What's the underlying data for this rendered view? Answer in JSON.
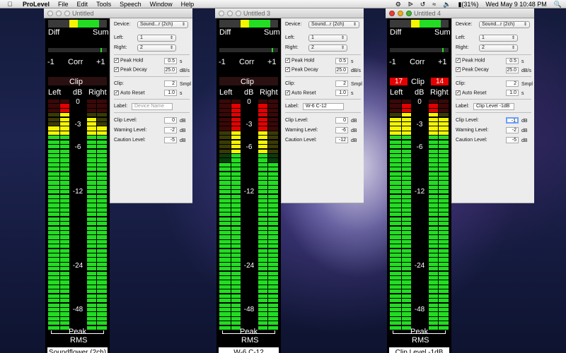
{
  "menubar": {
    "app_name": "ProLevel",
    "items": [
      "File",
      "Edit",
      "Tools",
      "Speech",
      "Window",
      "Help"
    ],
    "battery": "(31%)",
    "clock": "Wed May 9  10:48 PM"
  },
  "meter_labels": {
    "diff": "Diff",
    "sum": "Sum",
    "corr_min": "-1",
    "corr": "Corr",
    "corr_max": "+1",
    "clip": "Clip",
    "left": "Left",
    "db": "dB",
    "right": "Right",
    "scale": [
      "0",
      "-3",
      "-6",
      "-12",
      "-24",
      "-48"
    ],
    "peak": "Peak",
    "rms": "RMS"
  },
  "panel_labels": {
    "device": "Device:",
    "left": "Left:",
    "right": "Right:",
    "peak_hold": "Peak Hold",
    "peak_decay": "Peak Decay",
    "clip": "Clip:",
    "auto_reset": "Auto Reset",
    "label": "Label:",
    "clip_level": "Clip Level:",
    "warning_level": "Warning Level:",
    "caution_level": "Caution Level:",
    "unit_s": "s",
    "unit_dbs": "dB/s",
    "unit_smpl": "Smpl",
    "unit_db": "dB"
  },
  "windows": [
    {
      "title": "Untitled",
      "bottom_label": "Soundflower (2ch)",
      "device": "Sound...r (2ch)",
      "left_channel": "1",
      "right_channel": "2",
      "peak_hold": "0.5",
      "peak_decay": "25.0",
      "clip_samples": "2",
      "auto_reset": "1.0",
      "label_placeholder": "Device Name",
      "label_value": "",
      "clip_level": "0",
      "warning_level": "-2",
      "caution_level": "-5",
      "clip_left": "",
      "clip_right": "",
      "active": false,
      "levels": {
        "left_rms": 0.89,
        "left_peak": 0.98,
        "right_rms": 0.89,
        "right_peak": 0.92
      }
    },
    {
      "title": "Untitled 3",
      "bottom_label": "W-6 C-12",
      "device": "Sound...r (2ch)",
      "left_channel": "1",
      "right_channel": "2",
      "peak_hold": "0.5",
      "peak_decay": "25.0",
      "clip_samples": "2",
      "auto_reset": "1.0",
      "label_placeholder": "",
      "label_value": "W-6 C-12",
      "clip_level": "0",
      "warning_level": "-6",
      "caution_level": "-12",
      "clip_left": "",
      "clip_right": "",
      "active": false,
      "levels": {
        "left_rms": 0.73,
        "left_peak": 0.98,
        "right_rms": 0.73,
        "right_peak": 0.98
      }
    },
    {
      "title": "Untitled 4",
      "bottom_label": "Clip Level -1dB",
      "device": "Sound...r (2ch)",
      "left_channel": "1",
      "right_channel": "2",
      "peak_hold": "0.5",
      "peak_decay": "25.0",
      "clip_samples": "2",
      "auto_reset": "1.0",
      "label_placeholder": "",
      "label_value": "Clip Level -1dB",
      "clip_level": "-1",
      "warning_level": "-2",
      "caution_level": "-5",
      "clip_left": "17",
      "clip_right": "14",
      "active": true,
      "levels": {
        "left_rms": 0.93,
        "left_peak": 0.99,
        "right_rms": 0.93,
        "right_peak": 0.99
      }
    }
  ],
  "colors": {
    "green": "#22dd22",
    "yellow": "#f5f500",
    "red": "#e40000",
    "dim_green": "#0b3a0b",
    "dim_yellow": "#3a3a05",
    "dim_red": "#3a0808"
  }
}
